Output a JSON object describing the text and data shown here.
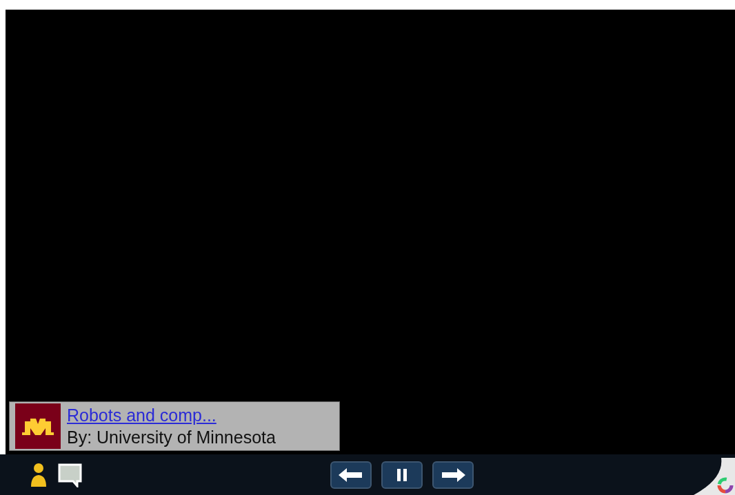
{
  "caption": {
    "title": "Robots and comp...",
    "byline": "By: University of Minnesota"
  },
  "controls": [
    {
      "kind": "prev"
    },
    {
      "kind": "pause"
    },
    {
      "kind": "next"
    }
  ]
}
